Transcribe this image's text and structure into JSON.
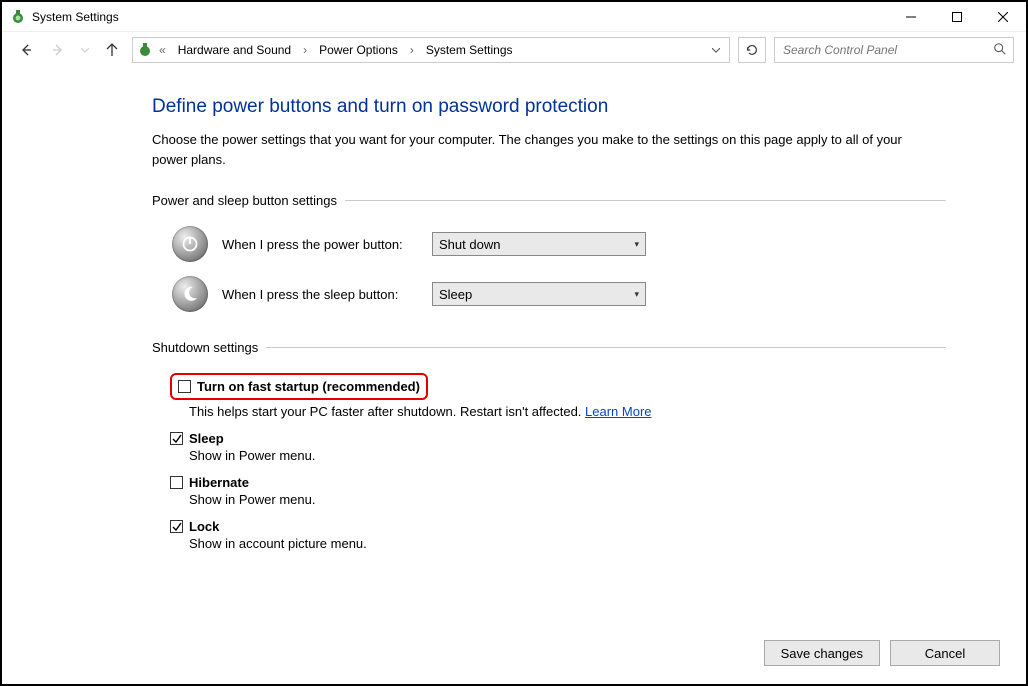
{
  "window": {
    "title": "System Settings"
  },
  "breadcrumb": {
    "root_symbol": "«",
    "items": [
      "Hardware and Sound",
      "Power Options",
      "System Settings"
    ]
  },
  "search": {
    "placeholder": "Search Control Panel"
  },
  "page": {
    "title": "Define power buttons and turn on password protection",
    "description": "Choose the power settings that you want for your computer. The changes you make to the settings on this page apply to all of your power plans."
  },
  "section1": {
    "header": "Power and sleep button settings",
    "power_label": "When I press the power button:",
    "power_value": "Shut down",
    "sleep_label": "When I press the sleep button:",
    "sleep_value": "Sleep"
  },
  "section2": {
    "header": "Shutdown settings",
    "items": [
      {
        "label": "Turn on fast startup (recommended)",
        "desc": "This helps start your PC faster after shutdown. Restart isn't affected. ",
        "link": "Learn More",
        "checked": false,
        "highlighted": true
      },
      {
        "label": "Sleep",
        "desc": "Show in Power menu.",
        "checked": true
      },
      {
        "label": "Hibernate",
        "desc": "Show in Power menu.",
        "checked": false
      },
      {
        "label": "Lock",
        "desc": "Show in account picture menu.",
        "checked": true
      }
    ]
  },
  "buttons": {
    "save": "Save changes",
    "cancel": "Cancel"
  }
}
